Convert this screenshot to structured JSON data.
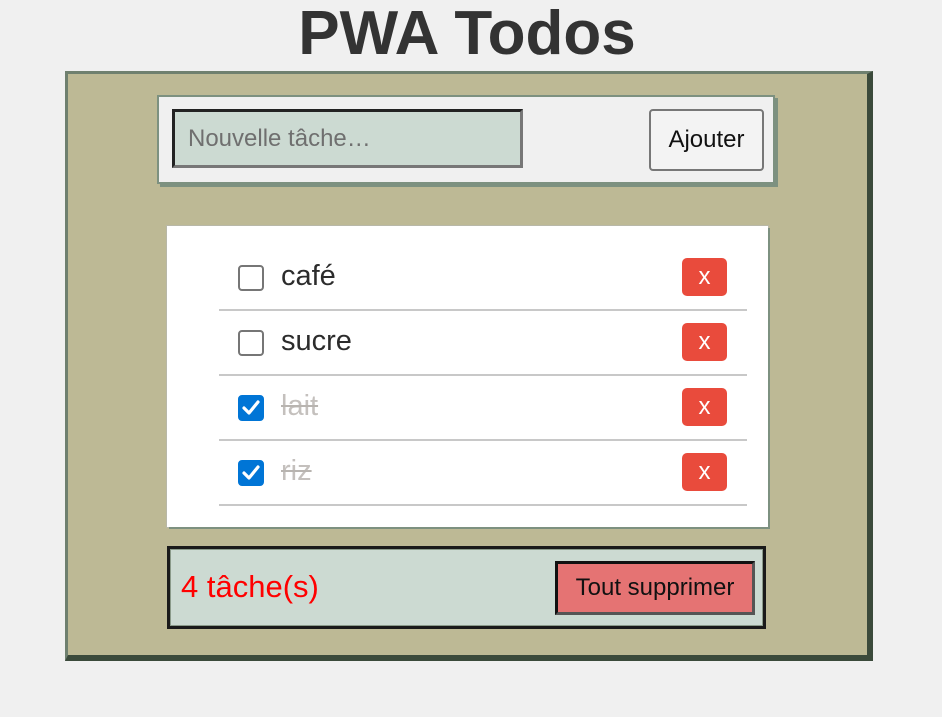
{
  "app": {
    "title": "PWA Todos"
  },
  "form": {
    "input_value": "",
    "input_placeholder": "Nouvelle tâche…",
    "add_label": "Ajouter"
  },
  "todos": [
    {
      "label": "café",
      "done": false,
      "delete_label": "x"
    },
    {
      "label": "sucre",
      "done": false,
      "delete_label": "x"
    },
    {
      "label": "lait",
      "done": true,
      "delete_label": "x"
    },
    {
      "label": "riz",
      "done": true,
      "delete_label": "x"
    }
  ],
  "footer": {
    "count_text": "4 tâche(s)",
    "clear_label": "Tout supprimer"
  },
  "colors": {
    "page_background": "#f0f0f0",
    "panel_background": "#bdb995",
    "input_background": "#ccdad2",
    "delete_button": "#e94b3c",
    "clear_button": "#e57373",
    "count_text": "#ff0000",
    "checkbox_checked": "#0075d6"
  },
  "icons": {
    "checkmark": "check-icon"
  }
}
